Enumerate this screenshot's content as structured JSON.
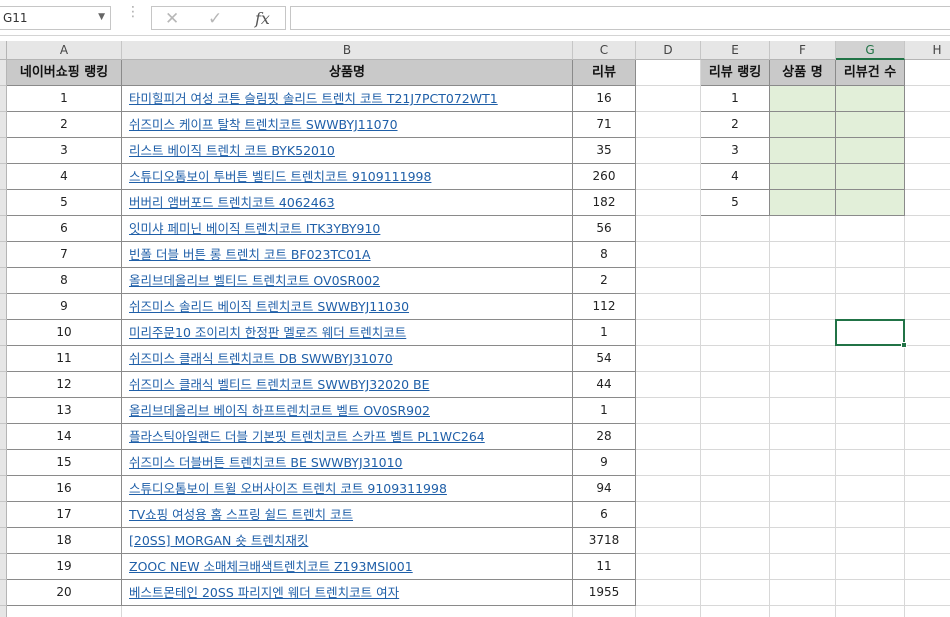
{
  "namebox": {
    "value": "G11"
  },
  "formula": {
    "value": ""
  },
  "columns": [
    "A",
    "B",
    "C",
    "D",
    "E",
    "F",
    "G",
    "H"
  ],
  "main_table": {
    "headers": [
      "네이버쇼핑 랭킹",
      "상품명",
      "리뷰"
    ],
    "rows": [
      [
        "1",
        "타미힐피거 여성 코튼 슬림핏 솔리드 트렌치 코트 T21J7PCT072WT1",
        "16"
      ],
      [
        "2",
        "쉬즈미스 케이프 탈착 트렌치코트 SWWBYJ11070",
        "71"
      ],
      [
        "3",
        "리스트 베이직 트렌치 코트 BYK52010",
        "35"
      ],
      [
        "4",
        "스튜디오톰보이 투버튼 벨티드 트렌치코트 9109111998",
        "260"
      ],
      [
        "5",
        "버버리 앰버포드 트렌치코트 4062463",
        "182"
      ],
      [
        "6",
        "잇미샤 페미닌 베이직 트렌치코트 ITK3YBY910",
        "56"
      ],
      [
        "7",
        "빈폴 더블 버튼 롱 트렌치 코트 BF023TC01A",
        "8"
      ],
      [
        "8",
        "올리브데올리브 벨티드 트렌치코트 OV0SR002",
        "2"
      ],
      [
        "9",
        "쉬즈미스 솔리드 베이직 트렌치코트 SWWBYJ11030",
        "112"
      ],
      [
        "10",
        "미리주문10 조이리치 한정판 멜로즈 웨더 트렌치코트",
        "1"
      ],
      [
        "11",
        "쉬즈미스 클래식 트렌치코트 DB SWWBYJ31070",
        "54"
      ],
      [
        "12",
        "쉬즈미스 클래식 벨티드 트렌치코트 SWWBYJ32020 BE",
        "44"
      ],
      [
        "13",
        "올리브데올리브 베이직 하프트렌치코트 벨트 OV0SR902",
        "1"
      ],
      [
        "14",
        "플라스틱아일랜드 더블 기본핏 트렌치코트 스카프 벨트 PL1WC264",
        "28"
      ],
      [
        "15",
        "쉬즈미스 더블버튼 트렌치코트 BE SWWBYJ31010",
        "9"
      ],
      [
        "16",
        "스튜디오톰보이 트윌 오버사이즈 트렌치 코트 9109311998",
        "94"
      ],
      [
        "17",
        "TV쇼핑 여성용 홈 스프링 쉴드 트렌치 코트",
        "6"
      ],
      [
        "18",
        "[20SS] MORGAN 숏 트렌치재킷",
        "3718"
      ],
      [
        "19",
        "ZOOC NEW 소매체크배색트렌치코트 Z193MSI001",
        "11"
      ],
      [
        "20",
        "베스트몬테인 20SS 파리지엔 웨더 트렌치코트 여자",
        "1955"
      ]
    ]
  },
  "side_table": {
    "headers": [
      "리뷰 랭킹",
      "상품 명",
      "리뷰건 수"
    ],
    "ranks": [
      "1",
      "2",
      "3",
      "4",
      "5"
    ]
  },
  "icons": {
    "cancel": "✕",
    "confirm": "✓",
    "function": "fx",
    "dropdown": "▼"
  },
  "colors": {
    "header_fill": "#c9c9c9",
    "link": "#1f5fa8",
    "input_fill": "#e2efd9",
    "selection": "#217346"
  }
}
